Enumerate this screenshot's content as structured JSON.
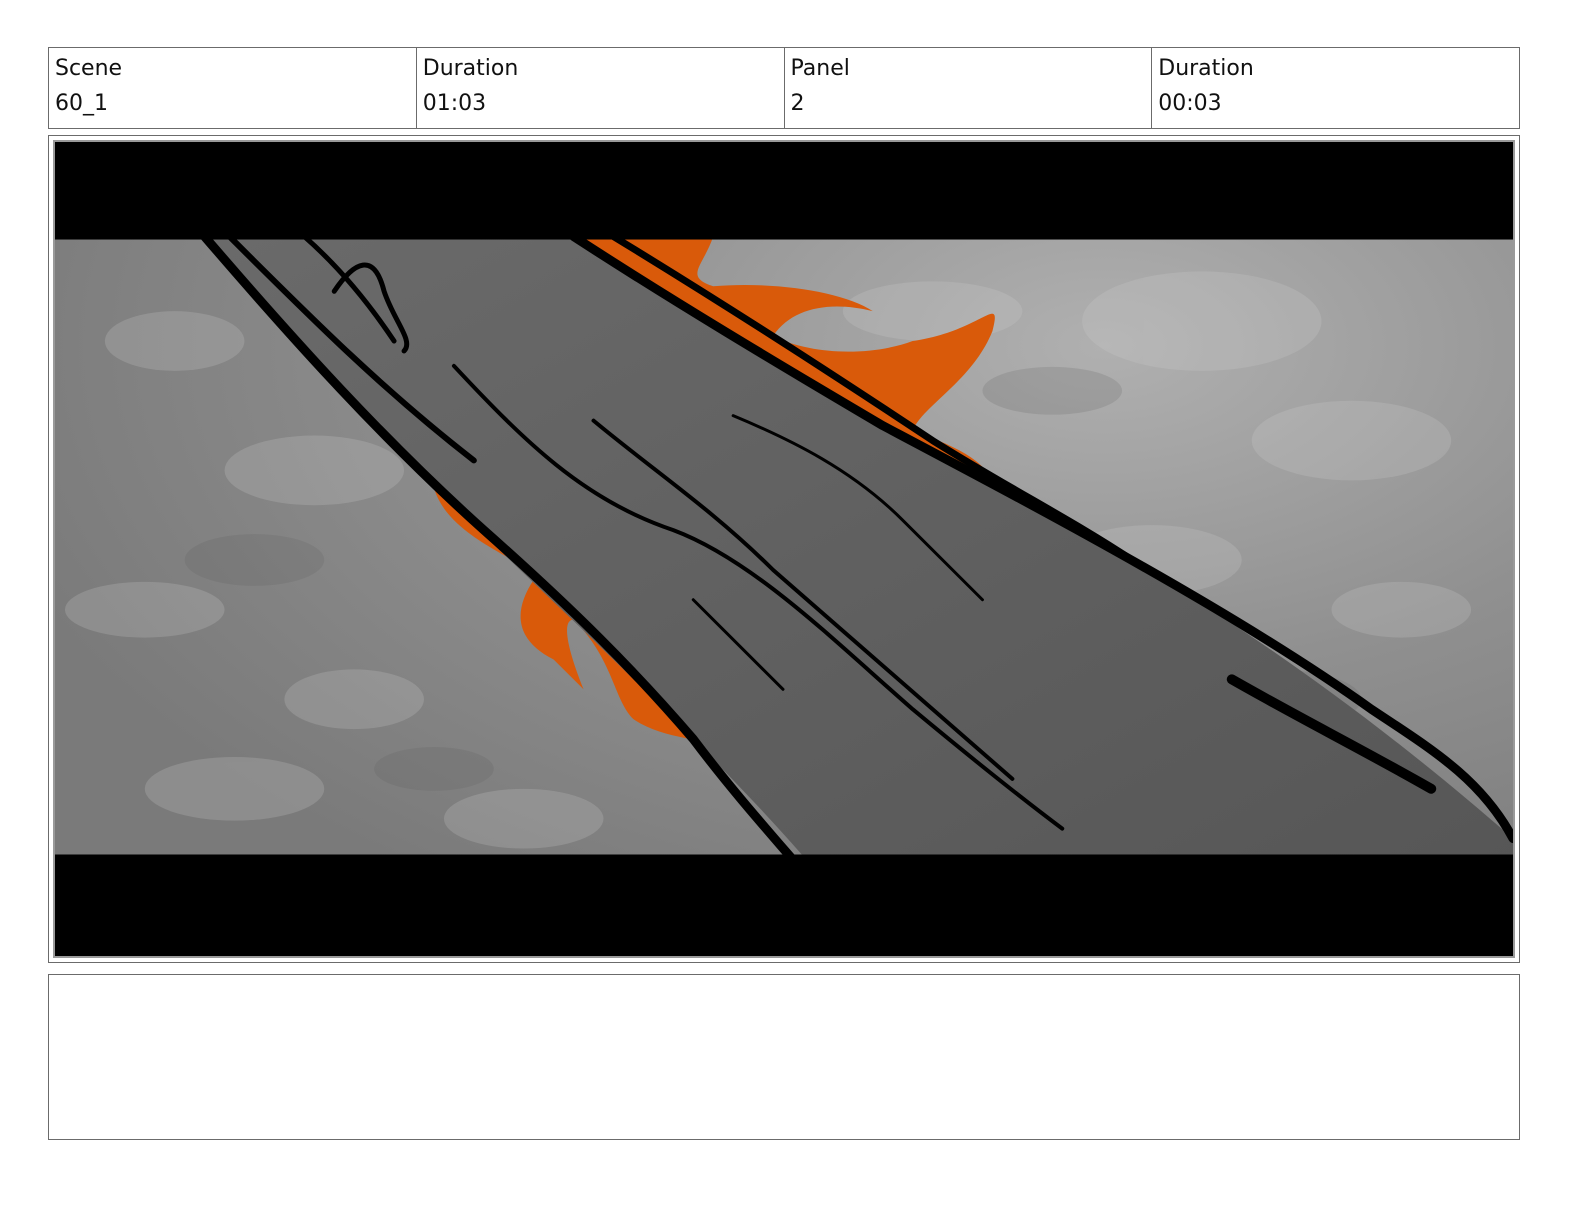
{
  "header": {
    "scene_label": "Scene",
    "scene_value": "60_1",
    "scene_duration_label": "Duration",
    "scene_duration_value": "01:03",
    "panel_label": "Panel",
    "panel_value": "2",
    "panel_duration_label": "Duration",
    "panel_duration_value": "00:03"
  },
  "panel_image": {
    "content": "storyboard-sketch",
    "colors": {
      "sky": "#8c8c8c",
      "trunk": "#5e5e5e",
      "flame": "#d95a0a",
      "ink": "#000000",
      "letterbox": "#000000"
    }
  },
  "notes": {
    "text": ""
  }
}
